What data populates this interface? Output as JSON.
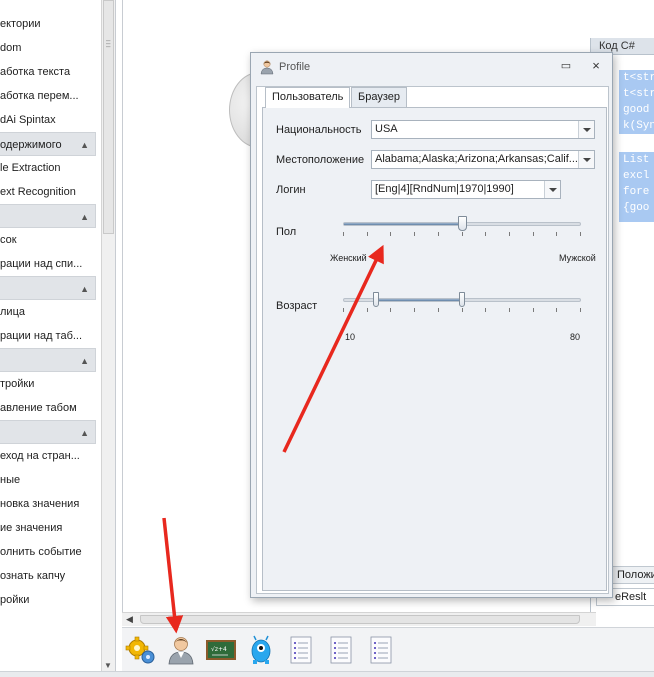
{
  "sidebar": {
    "items": [
      {
        "label": "ектории"
      },
      {
        "label": "dom"
      },
      {
        "label": "аботка текста"
      },
      {
        "label": "аботка перем..."
      },
      {
        "label": "dAi Spintax"
      },
      {
        "label": "одержимого",
        "section": true
      },
      {
        "label": "le Extraction"
      },
      {
        "label": "ext Recognition"
      },
      {
        "label": "",
        "section": true
      },
      {
        "label": "сок"
      },
      {
        "label": "рации над спи..."
      },
      {
        "label": "",
        "section": true
      },
      {
        "label": "лица"
      },
      {
        "label": "рации над таб..."
      },
      {
        "label": "",
        "section": true
      },
      {
        "label": "тройки"
      },
      {
        "label": "авление табом"
      },
      {
        "label": "",
        "section": true
      },
      {
        "label": "еход на стран..."
      },
      {
        "label": "ные"
      },
      {
        "label": "новка значения"
      },
      {
        "label": "ие значения"
      },
      {
        "label": "олнить событие"
      },
      {
        "label": "ознать капчу"
      },
      {
        "label": "ройки"
      }
    ]
  },
  "code_panel": {
    "tab_label": "Код C#",
    "block1": [
      "t<str",
      "t<str",
      " good",
      "k(Syn"
    ],
    "block2": [
      " List",
      " excl",
      " fore",
      " {goo"
    ],
    "bottom_tab_label": "Положи",
    "result_tab_label": "eReslt"
  },
  "toolbar": {
    "buttons": [
      {
        "icon": "gears-icon"
      },
      {
        "icon": "profile-icon"
      },
      {
        "icon": "chalkboard-icon"
      },
      {
        "icon": "alien-icon"
      },
      {
        "icon": "list-document-icon"
      },
      {
        "icon": "list-document-icon"
      },
      {
        "icon": "list-document-icon"
      }
    ]
  },
  "dialog": {
    "title": "Profile",
    "restore_glyph": "▭",
    "close_glyph": "×",
    "tabs": [
      {
        "label": "Пользователь",
        "active": true
      },
      {
        "label": "Браузер",
        "active": false
      }
    ],
    "fields": {
      "nationality_label": "Национальность",
      "nationality_value": "USA",
      "location_label": "Местоположение",
      "location_value": "Alabama;Alaska;Arizona;Arkansas;Calif...",
      "login_label": "Логин",
      "login_value": "[Eng|4][RndNum|1970|1990]",
      "gender_label": "Пол",
      "gender_min_label": "Женский",
      "gender_max_label": "Мужской",
      "gender_level": 0.5,
      "age_label": "Возраст",
      "age_min": "10",
      "age_max": "80",
      "age_range_fraction": [
        0.14,
        0.5
      ]
    }
  },
  "colors": {
    "accent_blue": "#a9c9f2",
    "annotation_red": "#e8281e"
  }
}
